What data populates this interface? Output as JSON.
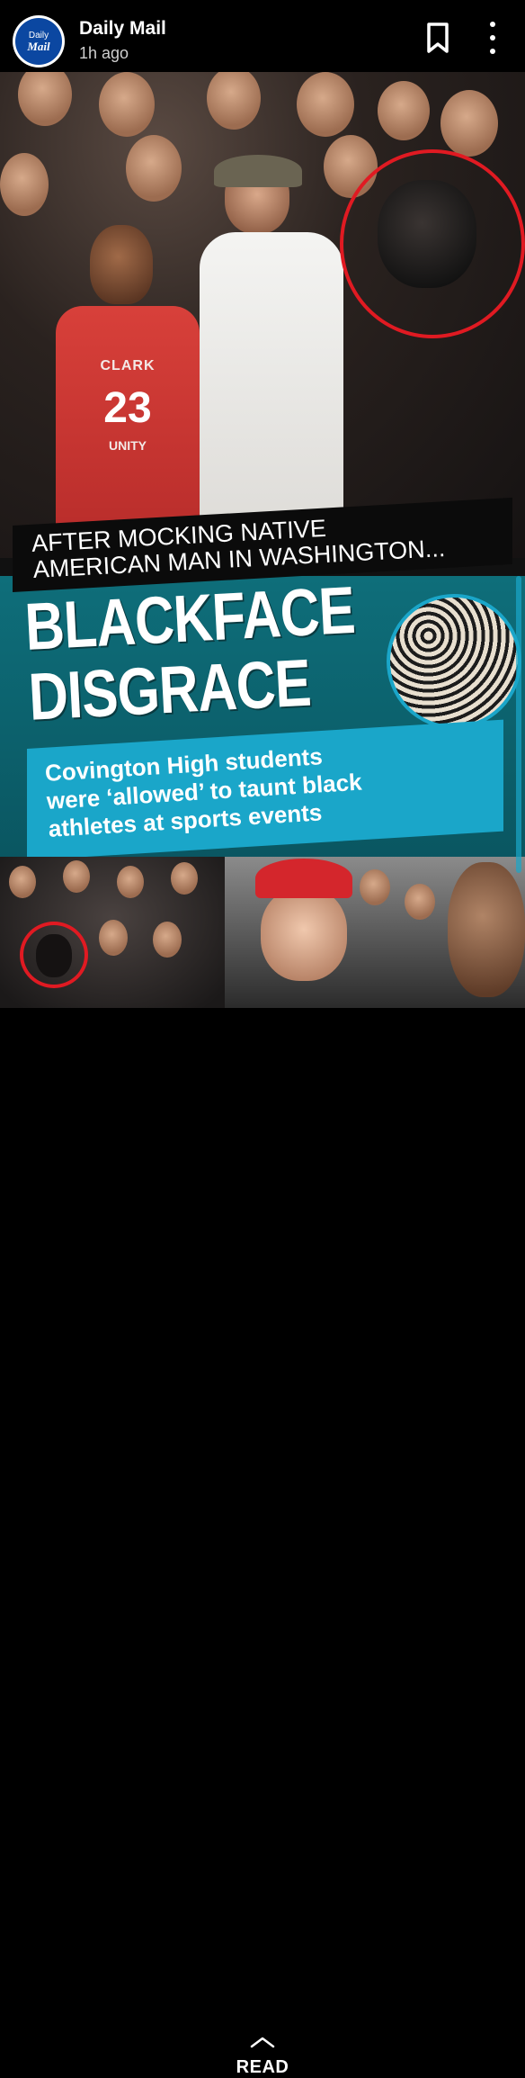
{
  "header": {
    "logo_line1": "Daily",
    "logo_line2": "Mail",
    "publisher": "Daily Mail",
    "time": "1h ago",
    "bookmark_icon": "bookmark-icon",
    "more_icon": "more-vertical-icon"
  },
  "story": {
    "jersey_school_top": "CLARK",
    "jersey_number": "23",
    "jersey_school_bottom": "UNITY",
    "kicker": "AFTER MOCKING NATIVE\nAMERICAN MAN IN WASHINGTON...",
    "headline": "BLACKFACE\nDISGRACE",
    "subheadline": "Covington High students\nwere ‘allowed’ to taunt black\nathletes at sports events"
  },
  "footer": {
    "chevron_icon": "chevron-up-icon",
    "read_label": "READ"
  },
  "colors": {
    "accent_red": "#e01a22",
    "accent_cyan": "#1aa6c9",
    "brand_blue": "#0b47a1",
    "teal_bg": "#0e6e7a"
  }
}
